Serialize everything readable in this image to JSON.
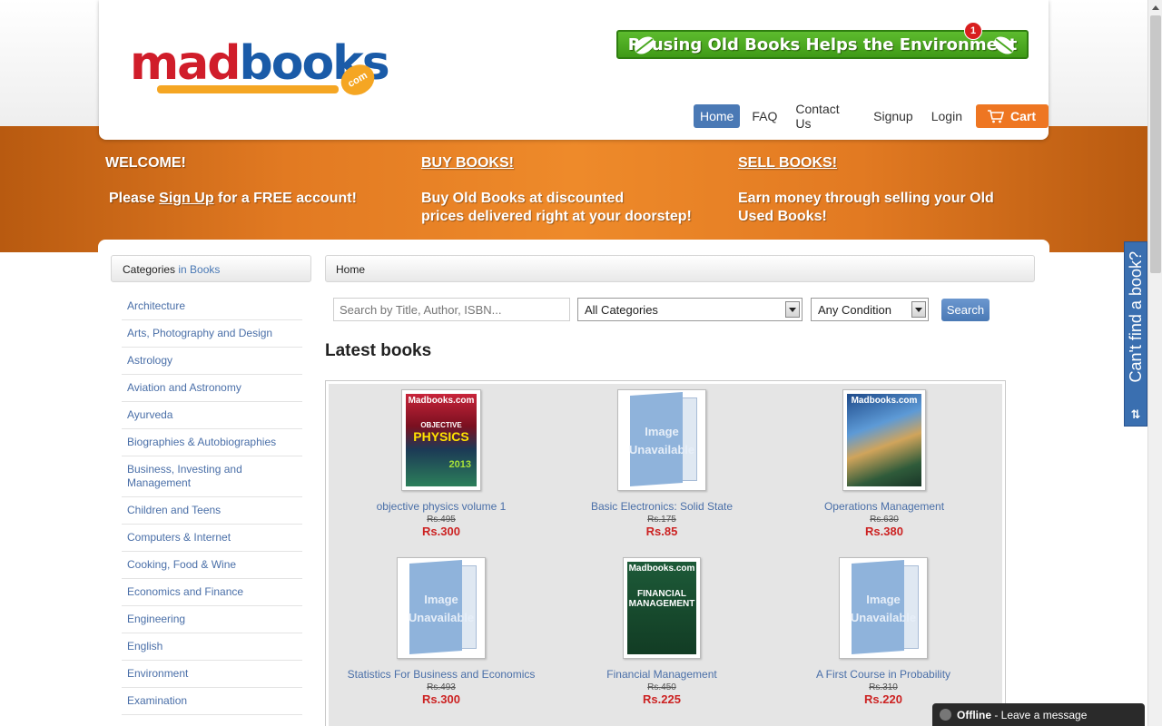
{
  "header": {
    "logo": {
      "mad": "mad",
      "books": "books",
      "com": "com"
    },
    "eco_banner": {
      "text": "Reusing Old Books Helps the Environment",
      "badge": "1"
    },
    "nav": {
      "home": "Home",
      "faq": "FAQ",
      "contact": "Contact Us",
      "signup": "Signup",
      "login": "Login",
      "cart": "Cart"
    }
  },
  "welcome": {
    "col1": {
      "heading": "WELCOME!",
      "pre": "Please ",
      "link": "Sign Up",
      "post": " for a FREE account!"
    },
    "col2": {
      "heading": "BUY BOOKS!",
      "line1": "Buy Old Books at discounted",
      "line2": "prices delivered right at your doorstep!"
    },
    "col3": {
      "heading": "SELL BOOKS!",
      "line1": "Earn money through selling your Old",
      "line2": "Used Books!"
    }
  },
  "sidebar": {
    "header_prefix": "Categories",
    "header_suffix": " in Books",
    "items": [
      "Architecture",
      "Arts, Photography and Design",
      "Astrology",
      "Aviation and Astronomy",
      "Ayurveda",
      "Biographies & Autobiographies",
      "Business, Investing and Management",
      "Children and Teens",
      "Computers & Internet",
      "Cooking, Food & Wine",
      "Economics and Finance",
      "Engineering",
      "English",
      "Environment",
      "Examination"
    ]
  },
  "breadcrumb": "Home",
  "search": {
    "placeholder": "Search by Title, Author, ISBN...",
    "category": "All Categories",
    "condition": "Any Condition",
    "button": "Search"
  },
  "latest_title": "Latest books",
  "books": [
    {
      "title": "objective physics volume 1",
      "old_price": "Rs.495",
      "price": "Rs.300"
    },
    {
      "title": "Basic Electronics: Solid State",
      "old_price": "Rs.175",
      "price": "Rs.85"
    },
    {
      "title": "Operations Management",
      "old_price": "Rs.630",
      "price": "Rs.380"
    },
    {
      "title": "Statistics For Business and Economics",
      "old_price": "Rs.493",
      "price": "Rs.300"
    },
    {
      "title": "Financial Management",
      "old_price": "Rs.450",
      "price": "Rs.225"
    },
    {
      "title": "A First Course in Probability",
      "old_price": "Rs.310",
      "price": "Rs.220"
    }
  ],
  "covers": {
    "watermark": "Madbooks.com",
    "physics_line1": "OBJECTIVE",
    "physics_line2": "PHYSICS",
    "physics_year": "2013",
    "fin_line1": "FINANCIAL",
    "fin_line2": "MANAGEMENT",
    "unavailable_1": "Image",
    "unavailable_2": "Unavailable"
  },
  "side_tab": {
    "text": "Can't find a book?",
    "arrows": "⇅"
  },
  "chat": {
    "status": "Offline",
    "message": " - Leave a message"
  },
  "colors": {
    "orange": "#e27a22",
    "blue": "#4a79b5",
    "price_red": "#cc2222",
    "eco_green": "#4aa820"
  }
}
